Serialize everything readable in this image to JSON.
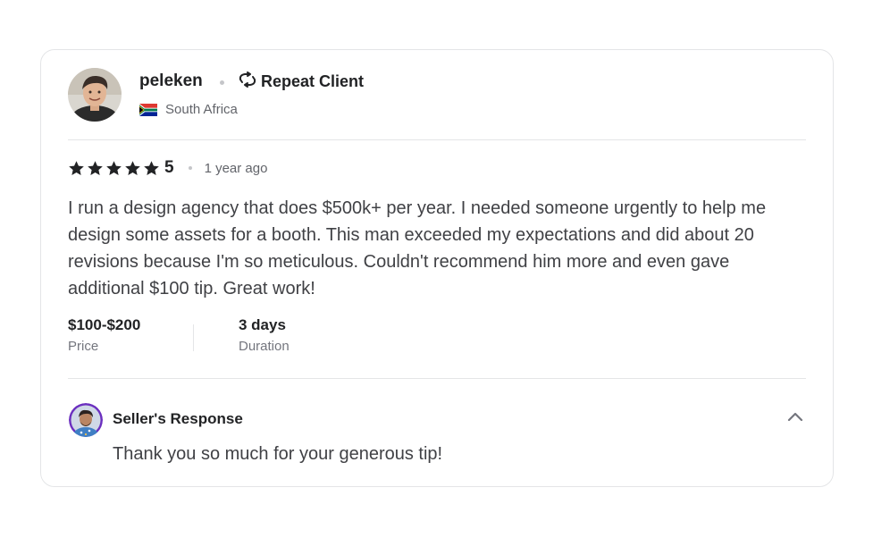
{
  "review": {
    "username": "peleken",
    "repeat_label": "Repeat Client",
    "country": "South Africa",
    "rating": "5",
    "stars": 5,
    "time_ago": "1 year ago",
    "text": "I run a design agency that does $500k+ per year. I needed someone urgently to help me design some assets for a booth. This man exceeded my expectations and did about 20 revisions because I'm so meticulous. Couldn't recommend him more and even gave additional $100 tip. Great work!",
    "price_value": "$100-$200",
    "price_label": "Price",
    "duration_value": "3 days",
    "duration_label": "Duration"
  },
  "seller_response": {
    "title": "Seller's Response",
    "text": "Thank you so much for your generous tip!"
  },
  "icons": {
    "repeat": "repeat-arrows-icon",
    "star": "star-icon",
    "chevron": "chevron-up-icon",
    "flag": "south-africa-flag-icon"
  },
  "colors": {
    "star": "#222325",
    "text": "#404145",
    "muted": "#62646a",
    "border": "#e4e5e7",
    "seller_ring": "#6b2fbf"
  }
}
